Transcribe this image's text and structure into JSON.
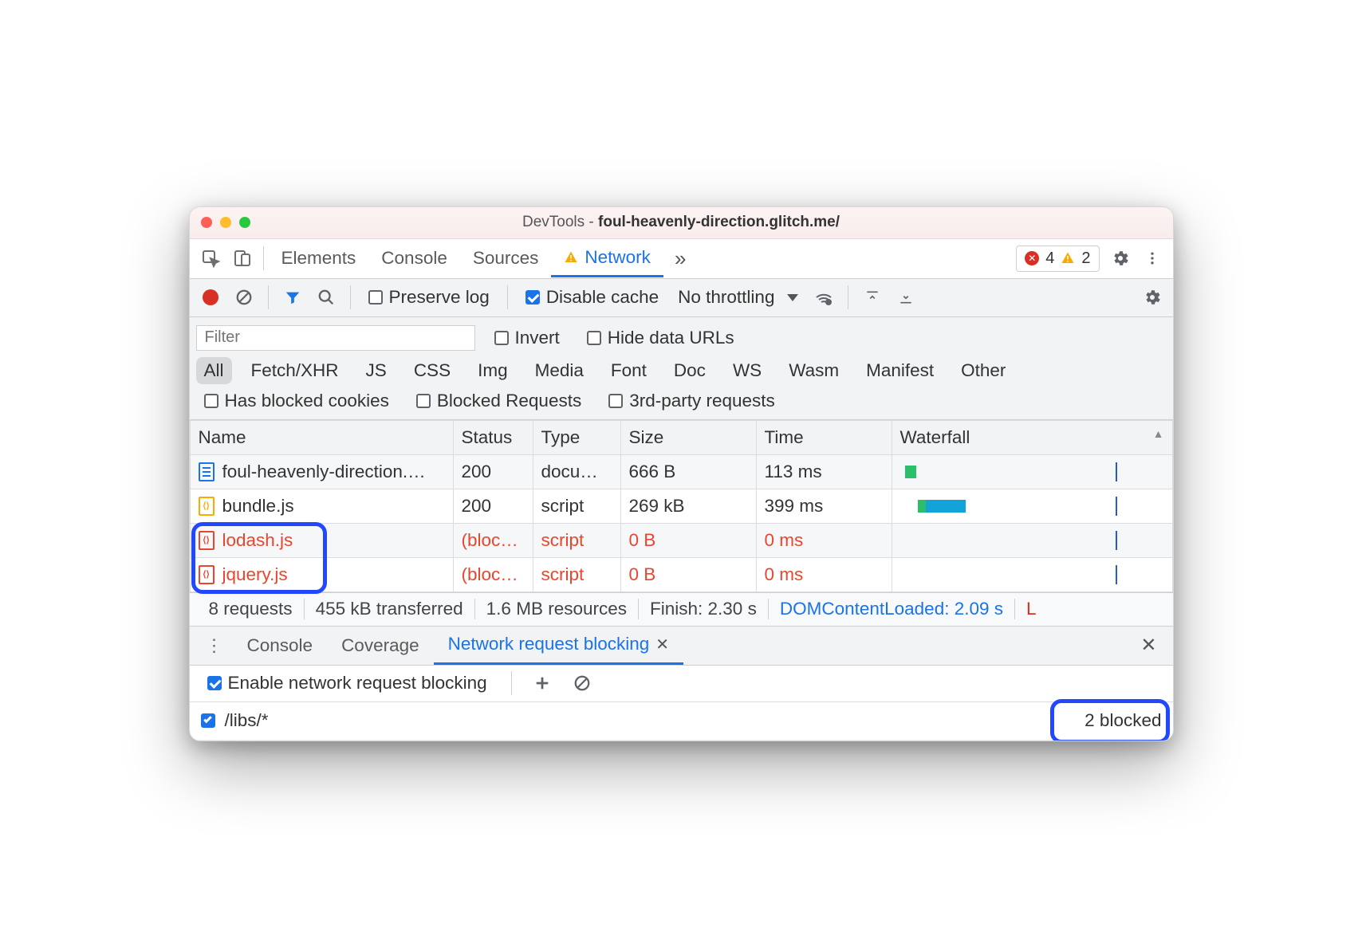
{
  "window": {
    "title_prefix": "DevTools - ",
    "title_url": "foul-heavenly-direction.glitch.me/"
  },
  "tabs": {
    "items": [
      "Elements",
      "Console",
      "Sources",
      "Network"
    ],
    "active": "Network",
    "overflow_glyph": "»",
    "error_count": "4",
    "warning_count": "2"
  },
  "toolbar": {
    "preserve_log": "Preserve log",
    "disable_cache": "Disable cache",
    "throttling": "No throttling"
  },
  "filterbar": {
    "placeholder": "Filter",
    "invert": "Invert",
    "hide_data_urls": "Hide data URLs",
    "types": [
      "All",
      "Fetch/XHR",
      "JS",
      "CSS",
      "Img",
      "Media",
      "Font",
      "Doc",
      "WS",
      "Wasm",
      "Manifest",
      "Other"
    ],
    "active_type": "All",
    "has_blocked_cookies": "Has blocked cookies",
    "blocked_requests": "Blocked Requests",
    "third_party": "3rd-party requests"
  },
  "columns": {
    "name": "Name",
    "status": "Status",
    "type": "Type",
    "size": "Size",
    "time": "Time",
    "waterfall": "Waterfall"
  },
  "rows": [
    {
      "name": "foul-heavenly-direction.…",
      "status": "200",
      "type": "docum…",
      "size": "666 B",
      "time": "113 ms",
      "icon": "doc",
      "blocked": false
    },
    {
      "name": "bundle.js",
      "status": "200",
      "type": "script",
      "size": "269 kB",
      "time": "399 ms",
      "icon": "js",
      "blocked": false
    },
    {
      "name": "lodash.js",
      "status": "(bloc…",
      "type": "script",
      "size": "0 B",
      "time": "0 ms",
      "icon": "red",
      "blocked": true
    },
    {
      "name": "jquery.js",
      "status": "(bloc…",
      "type": "script",
      "size": "0 B",
      "time": "0 ms",
      "icon": "red",
      "blocked": true
    }
  ],
  "status": {
    "requests": "8 requests",
    "transferred": "455 kB transferred",
    "resources": "1.6 MB resources",
    "finish": "Finish: 2.30 s",
    "dcl": "DOMContentLoaded: 2.09 s",
    "load": "L"
  },
  "drawer": {
    "tabs": [
      "Console",
      "Coverage",
      "Network request blocking"
    ],
    "active": "Network request blocking",
    "enable_label": "Enable network request blocking",
    "pattern": "/libs/*",
    "blocked_count": "2 blocked"
  }
}
